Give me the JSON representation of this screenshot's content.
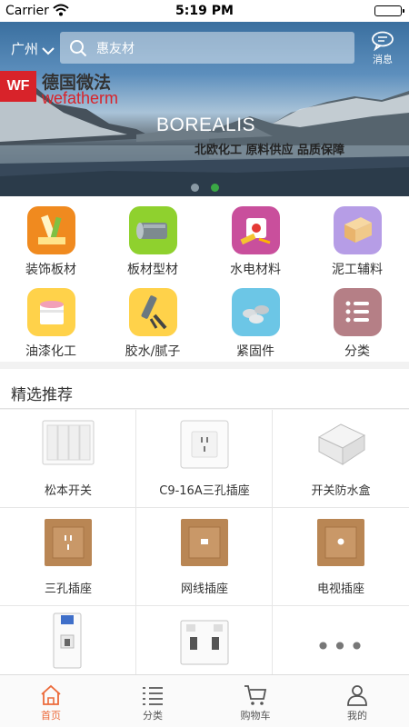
{
  "status_bar": {
    "carrier": "Carrier",
    "time": "5:19 PM"
  },
  "header": {
    "city": "广州",
    "search_placeholder": "惠友材",
    "message_label": "消息"
  },
  "banner": {
    "logo_mark": "WF",
    "brand_cn": "德国微法",
    "brand_en": "wefatherm",
    "headline": "BOREALIS",
    "slogan": "北欧化工  原料供应  品质保障",
    "slide_count": 2,
    "active_slide": 2
  },
  "categories": [
    {
      "label": "装饰板材",
      "icon": "decor-board-icon",
      "color": "#f08a1f"
    },
    {
      "label": "板材型材",
      "icon": "profile-pipe-icon",
      "color": "#8fd12e"
    },
    {
      "label": "水电材料",
      "icon": "electrical-icon",
      "color": "#c94f9c"
    },
    {
      "label": "泥工辅料",
      "icon": "masonry-icon",
      "color": "#b69de6"
    },
    {
      "label": "油漆化工",
      "icon": "paint-bucket-icon",
      "color": "#ffd24a"
    },
    {
      "label": "胶水/腻子",
      "icon": "caulk-gun-icon",
      "color": "#ffd24a"
    },
    {
      "label": "紧固件",
      "icon": "fastener-icon",
      "color": "#6cc6e6"
    },
    {
      "label": "分类",
      "icon": "list-icon",
      "color": "#b57f86"
    }
  ],
  "recommend": {
    "title": "精选推荐",
    "items": [
      {
        "name": "松本开关",
        "image": "wall-switch-icon"
      },
      {
        "name": "C9-16A三孔插座",
        "image": "socket-icon"
      },
      {
        "name": "开关防水盒",
        "image": "waterproof-box-icon"
      },
      {
        "name": "三孔插座",
        "image": "gold-socket-icon"
      },
      {
        "name": "网线插座",
        "image": "network-socket-icon"
      },
      {
        "name": "电视插座",
        "image": "tv-socket-icon"
      },
      {
        "name": "",
        "image": "circuit-breaker-icon"
      },
      {
        "name": "",
        "image": "leakage-breaker-icon"
      },
      {
        "name": "",
        "image": "more-icon"
      }
    ]
  },
  "tabbar": {
    "tabs": [
      {
        "label": "首页",
        "icon": "home-icon",
        "active": true
      },
      {
        "label": "分类",
        "icon": "list-icon",
        "active": false
      },
      {
        "label": "购物车",
        "icon": "cart-icon",
        "active": false
      },
      {
        "label": "我的",
        "icon": "profile-icon",
        "active": false
      }
    ],
    "active_color": "#ec6a3a"
  }
}
